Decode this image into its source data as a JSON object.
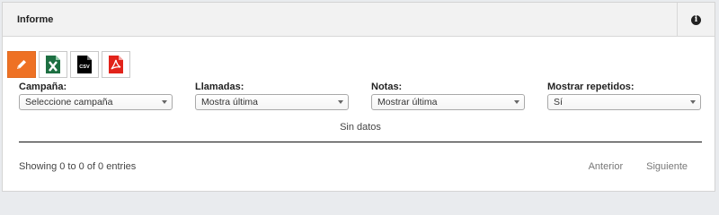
{
  "panel": {
    "title": "Informe",
    "info_icon": "info-circle-icon"
  },
  "toolbar": {
    "buttons": [
      {
        "name": "edit",
        "icon": "pencil-icon",
        "color": "#ee7124"
      },
      {
        "name": "excel",
        "icon": "excel-file-icon",
        "color": "#1d6f42"
      },
      {
        "name": "csv",
        "icon": "csv-file-icon",
        "label": "CSV",
        "color": "#000000"
      },
      {
        "name": "pdf",
        "icon": "pdf-file-icon",
        "color": "#e2231a"
      }
    ]
  },
  "filters": [
    {
      "label": "Campaña:",
      "value": "Seleccione campaña"
    },
    {
      "label": "Llamadas:",
      "value": "Mostra última"
    },
    {
      "label": "Notas:",
      "value": "Mostrar última"
    },
    {
      "label": "Mostrar repetidos:",
      "value": "Sí"
    }
  ],
  "table": {
    "empty_text": "Sin datos"
  },
  "footer": {
    "info": "Showing 0 to 0 of 0 entries",
    "prev": "Anterior",
    "next": "Siguiente"
  },
  "colors": {
    "accent": "#ee7124",
    "header_bg": "#f2f2f2"
  }
}
